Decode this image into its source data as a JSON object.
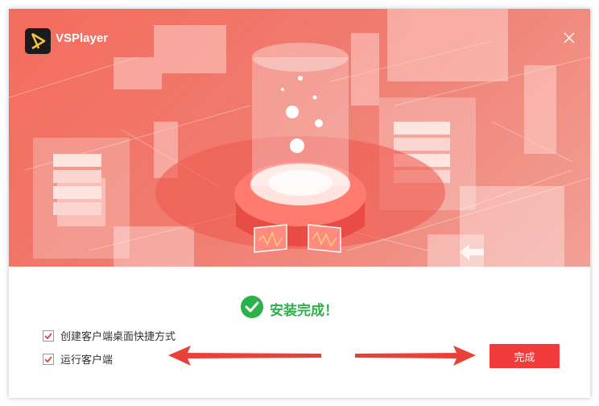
{
  "window": {
    "app_title": "VSPlayer",
    "close_icon": "close-icon",
    "logo_icon": "play-logo-icon"
  },
  "status": {
    "icon": "check-circle-icon",
    "text": "安装完成！",
    "color": "#2ab14a"
  },
  "options": [
    {
      "label": "创建客户端桌面快捷方式",
      "checked": true
    },
    {
      "label": "运行客户端",
      "checked": true
    }
  ],
  "finish_button": {
    "label": "完成",
    "color": "#f23c3c"
  },
  "annotations": {
    "arrow_color": "#e8413a"
  }
}
